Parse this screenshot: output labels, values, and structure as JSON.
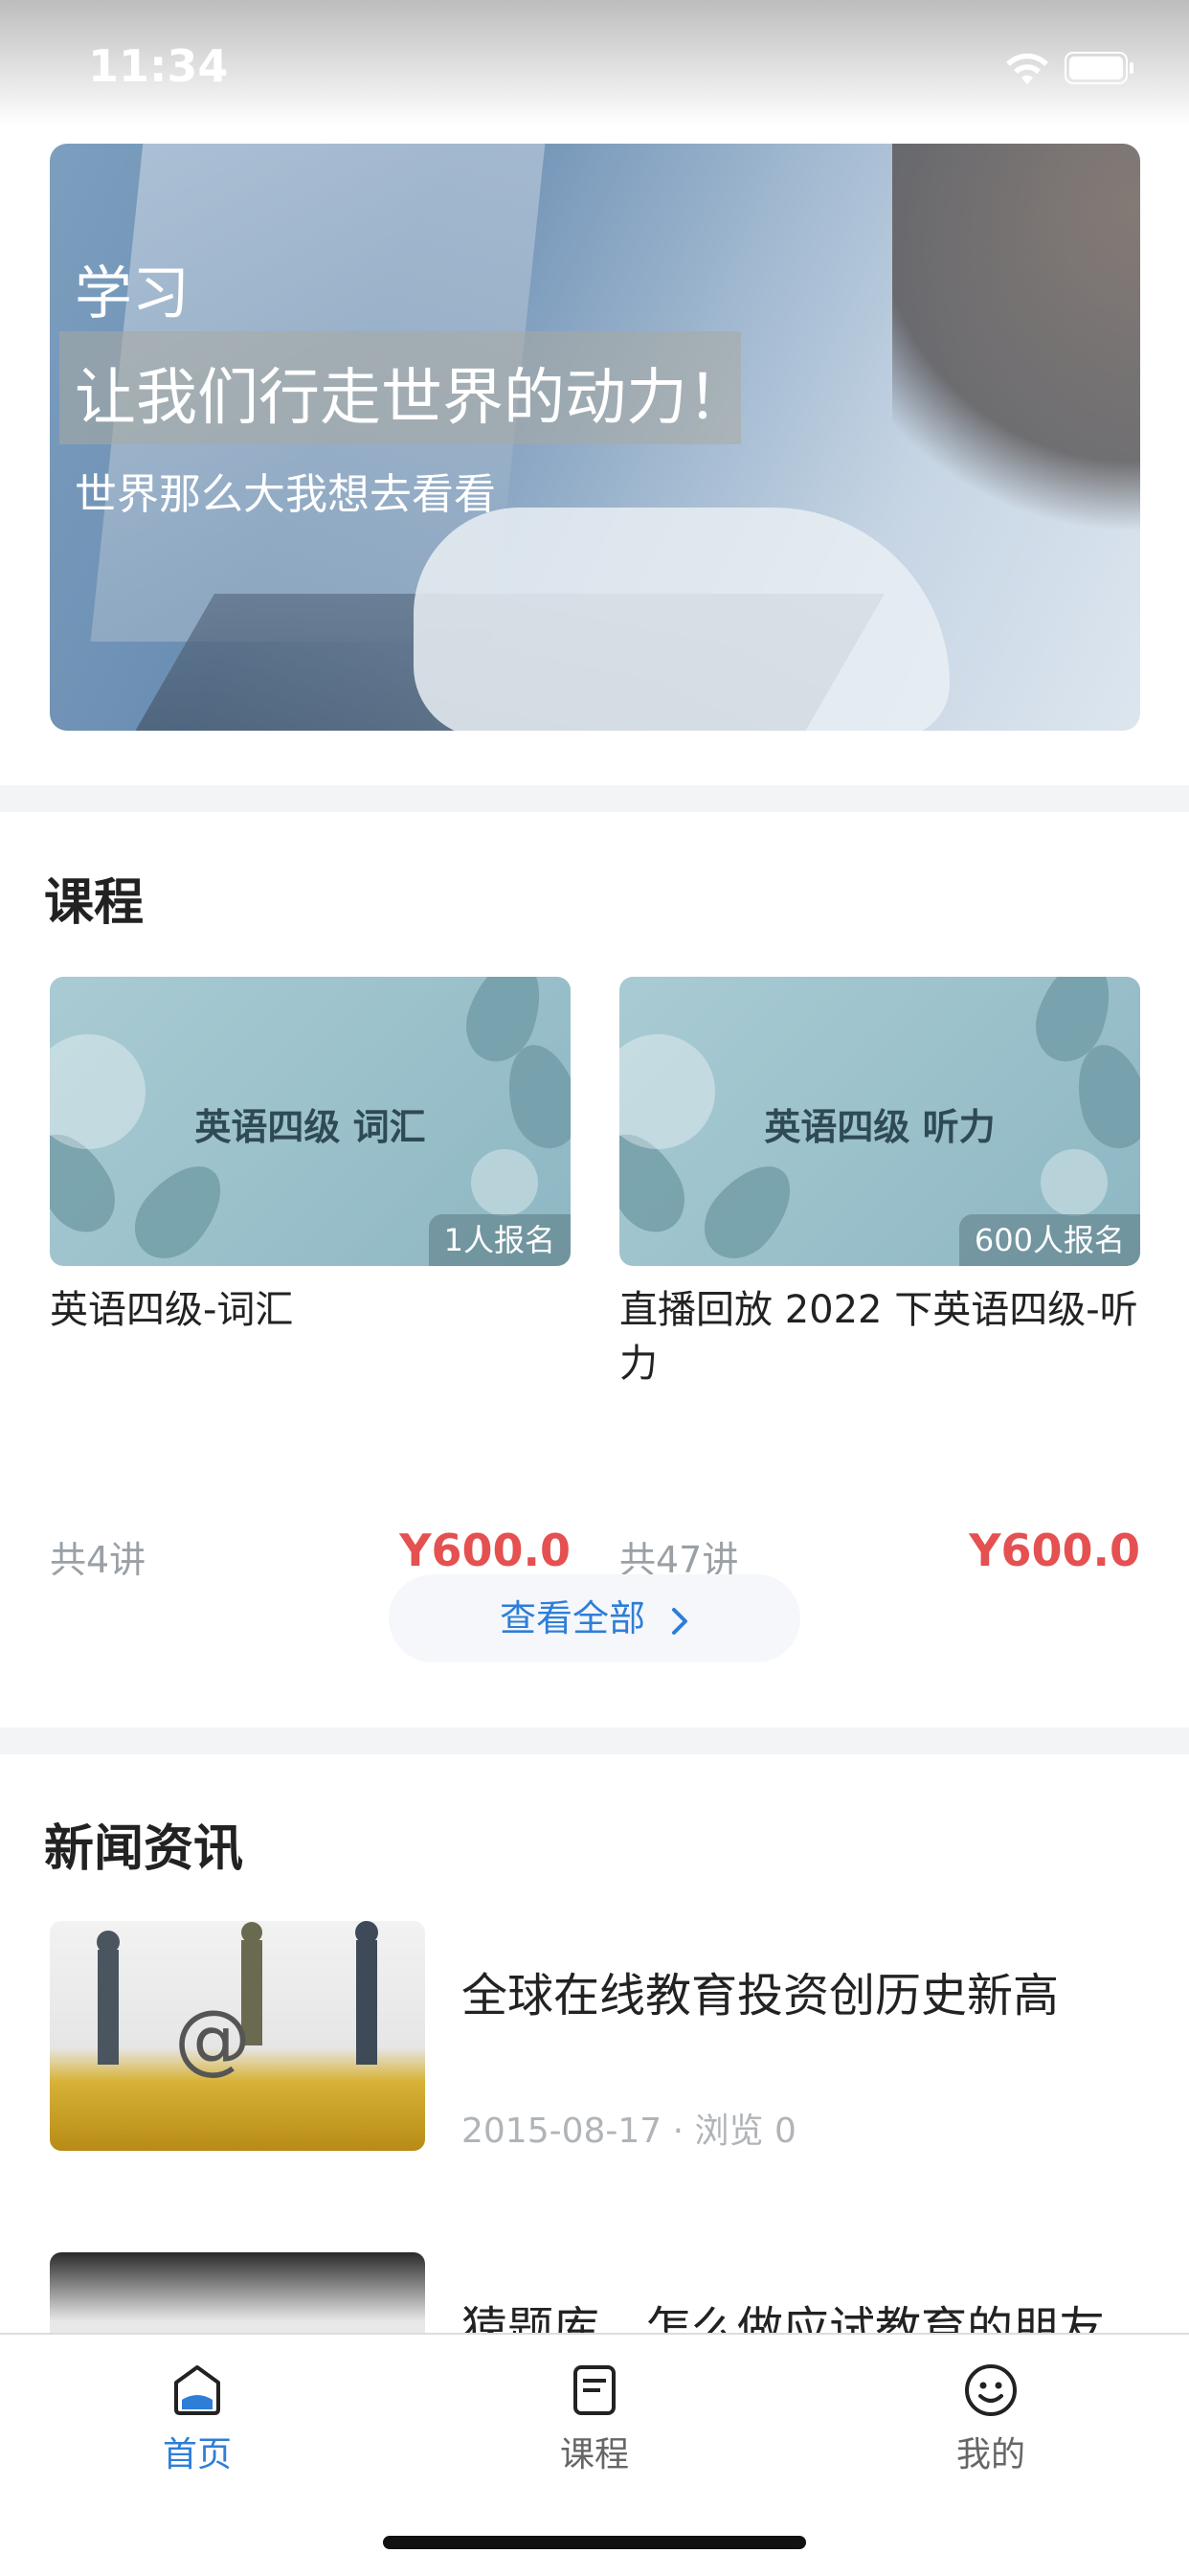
{
  "status_bar": {
    "time": "11:34"
  },
  "banner": {
    "title": "学习",
    "headline": "让我们行走世界的动力！",
    "subtitle": "世界那么大我想去看看"
  },
  "courses": {
    "section_title": "课程",
    "items": [
      {
        "thumb_title": "英语四级 词汇",
        "enrolled": "1人报名",
        "name": "英语四级-词汇",
        "lessons": "共4讲",
        "price": "Y600.0"
      },
      {
        "thumb_title": "英语四级 听力",
        "enrolled": "600人报名",
        "name": "直播回放 2022 下英语四级-听力",
        "lessons": "共47讲",
        "price": "Y600.0"
      }
    ],
    "view_all": "查看全部"
  },
  "news": {
    "section_title": "新闻资讯",
    "items": [
      {
        "title": "全球在线教育投资创历史新高",
        "meta": "2015-08-17 · 浏览 0"
      },
      {
        "title": "猿题库，怎么做应试教育的朋友",
        "meta": ""
      }
    ]
  },
  "tab_bar": {
    "items": [
      {
        "label": "首页",
        "icon": "home-icon",
        "active": true
      },
      {
        "label": "课程",
        "icon": "course-icon",
        "active": false
      },
      {
        "label": "我的",
        "icon": "profile-icon",
        "active": false
      }
    ]
  },
  "colors": {
    "accent": "#2e7ed8",
    "price": "#e55050"
  }
}
